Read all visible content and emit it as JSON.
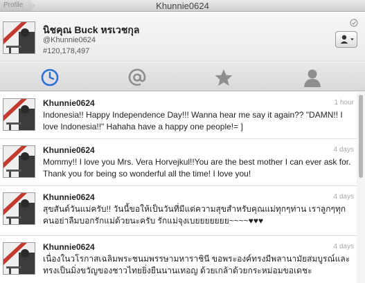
{
  "window": {
    "back_label": "Profile",
    "title": "Khunnie0624"
  },
  "profile": {
    "display_name": "นิชคุณ Buck หรเวชกุล",
    "handle": "@Khunnie0624",
    "id_number": "#120,178,497"
  },
  "tabs": [
    {
      "name": "timeline",
      "icon": "clock-icon",
      "active": true
    },
    {
      "name": "mentions",
      "icon": "at-icon",
      "active": false
    },
    {
      "name": "favorites",
      "icon": "star-icon",
      "active": false
    },
    {
      "name": "profile",
      "icon": "person-icon",
      "active": false
    }
  ],
  "colors": {
    "active_tab": "#2b6fd6",
    "inactive_tab": "#8e8e8e"
  },
  "tweets": [
    {
      "user": "Khunnie0624",
      "time": "1 hour",
      "text": "Indonesia!! Happy Independence Day!!! Wanna hear me say it again?? \"DAMN!! I love Indonesia!!\" Hahaha have a happy one people!= ]"
    },
    {
      "user": "Khunnie0624",
      "time": "4 days",
      "text": "Mommy!! I love you Mrs. Vera Horvejkul!!You are the best mother I can ever ask for. Thank you for being so wonderful all the time! I love you!"
    },
    {
      "user": "Khunnie0624",
      "time": "4 days",
      "text": "สุขสันต์วันแม่ครับ!! วันนี้ขอให้เป็นวันที่มีแต่ความสุขสำหรับคุณแม่ทุกๆท่าน เราลูกๆทุกคนอย่าลืมบอกรักแม่ด้วยนะครับ รักแม่จุงเบยยยยยยย~~~~♥♥♥"
    },
    {
      "user": "Khunnie0624",
      "time": "4 days",
      "text": "เนื่องในวโรกาสเฉลิมพระชนมพรรษามหาราชินี ขอพระองค์ทรงมีพลานามัยสมบูรณ์และทรงเป็นมิ่งขวัญของชาวไทยยิ่งยืนนานเทอญ ด้วยเกล้าด้วยกระหม่อมขอเดชะ"
    }
  ]
}
